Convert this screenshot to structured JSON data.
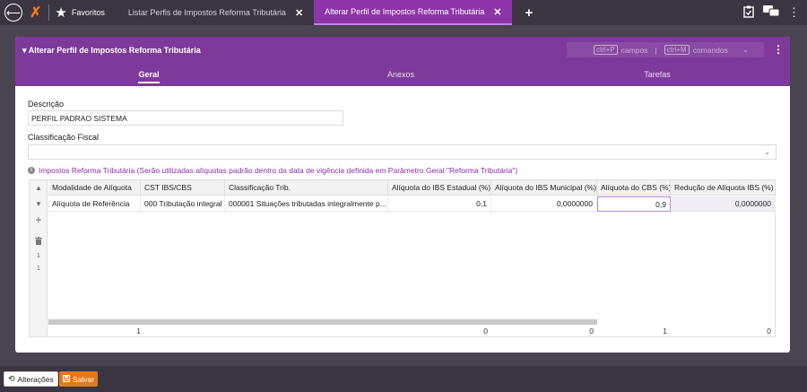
{
  "topbar": {
    "favorites_label": "Favoritos",
    "tabs": [
      {
        "label": "Listar Perfis de Impostos Reforma Tributária",
        "active": false
      },
      {
        "label": "Alterar Perfil de Impostos Reforma Tributária",
        "active": true
      }
    ],
    "close_glyph": "✕",
    "add_glyph": "+"
  },
  "panel": {
    "title": "Alterar Perfil de Impostos Reforma Tributária",
    "shortcuts": {
      "key1": "ctrl+P",
      "text1": "campos",
      "divider": "|",
      "key2": "ctrl+M",
      "text2": "comandos"
    },
    "tabs": [
      {
        "label": "Geral",
        "active": true
      },
      {
        "label": "Anexos",
        "active": false
      },
      {
        "label": "Tarefas",
        "active": false
      }
    ]
  },
  "form": {
    "descricao_label": "Descrição",
    "descricao_value": "PERFIL PADRAO SISTEMA",
    "classificacao_label": "Classificação Fiscal",
    "classificacao_value": ""
  },
  "info_text": "Impostos Reforma Tributária (Serão utilizadas alíquotas padrão dentro da data de vigência definida em Parâmetro Geral \"Reforma Tributária\")",
  "grid": {
    "columns": [
      "Modalidade de Alíquota",
      "CST IBS/CBS",
      "Classificação Trib.",
      "Alíquota do IBS Estadual (%)",
      "Alíquota do IBS Municipal (%)",
      "Alíquota do CBS (%)",
      "Redução de Alíquota IBS (%)"
    ],
    "rows": [
      [
        "Alíquota de Referência",
        "000 Tributação integral",
        "000001 Situações tributadas integralmente p...",
        "0,1",
        "0,0000000",
        "0,9",
        "0,0000000"
      ]
    ],
    "gutter_numbers": [
      "1",
      "1"
    ],
    "footer": [
      "1",
      "0",
      "0",
      "1",
      "0"
    ]
  },
  "bottom": {
    "alteracoes_label": "Alterações",
    "salvar_label": "Salvar"
  },
  "colors": {
    "accent": "#8c34a8",
    "panel_header": "#7e3a9a",
    "save_button": "#e07a1c"
  }
}
